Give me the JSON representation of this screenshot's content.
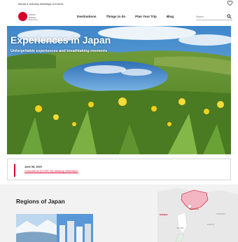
{
  "topbar": {
    "links": "Media & Industry   Meetings & Events",
    "heart_icon": "heart-icon"
  },
  "logo": {
    "mark_color": "#d7002a",
    "line1": "JAPAN",
    "line2": "Endless",
    "line3": "Discovery"
  },
  "nav": {
    "items": [
      {
        "label": "Destinations"
      },
      {
        "label": "Things to do"
      },
      {
        "label": "Plan Your Trip"
      },
      {
        "label": "Blog"
      }
    ],
    "search_placeholder": "Search",
    "search_icon": "magnifier-icon"
  },
  "hero": {
    "title": "Experiences in Japan",
    "subtitle": "Unforgettable experiences and breathtaking moments"
  },
  "advisory": {
    "date": "June 08, 2020",
    "link": "Coronavirus (COVID-19) advisory information"
  },
  "regions": {
    "heading": "Regions of Japan",
    "map_labels": {
      "hokkaido": "Hokkaido",
      "kansai": "KANSAI",
      "tohoku": "TOHOKU",
      "kanto": "KANTO",
      "chubu": "CHUBU"
    }
  },
  "colors": {
    "accent": "#d7002a"
  }
}
